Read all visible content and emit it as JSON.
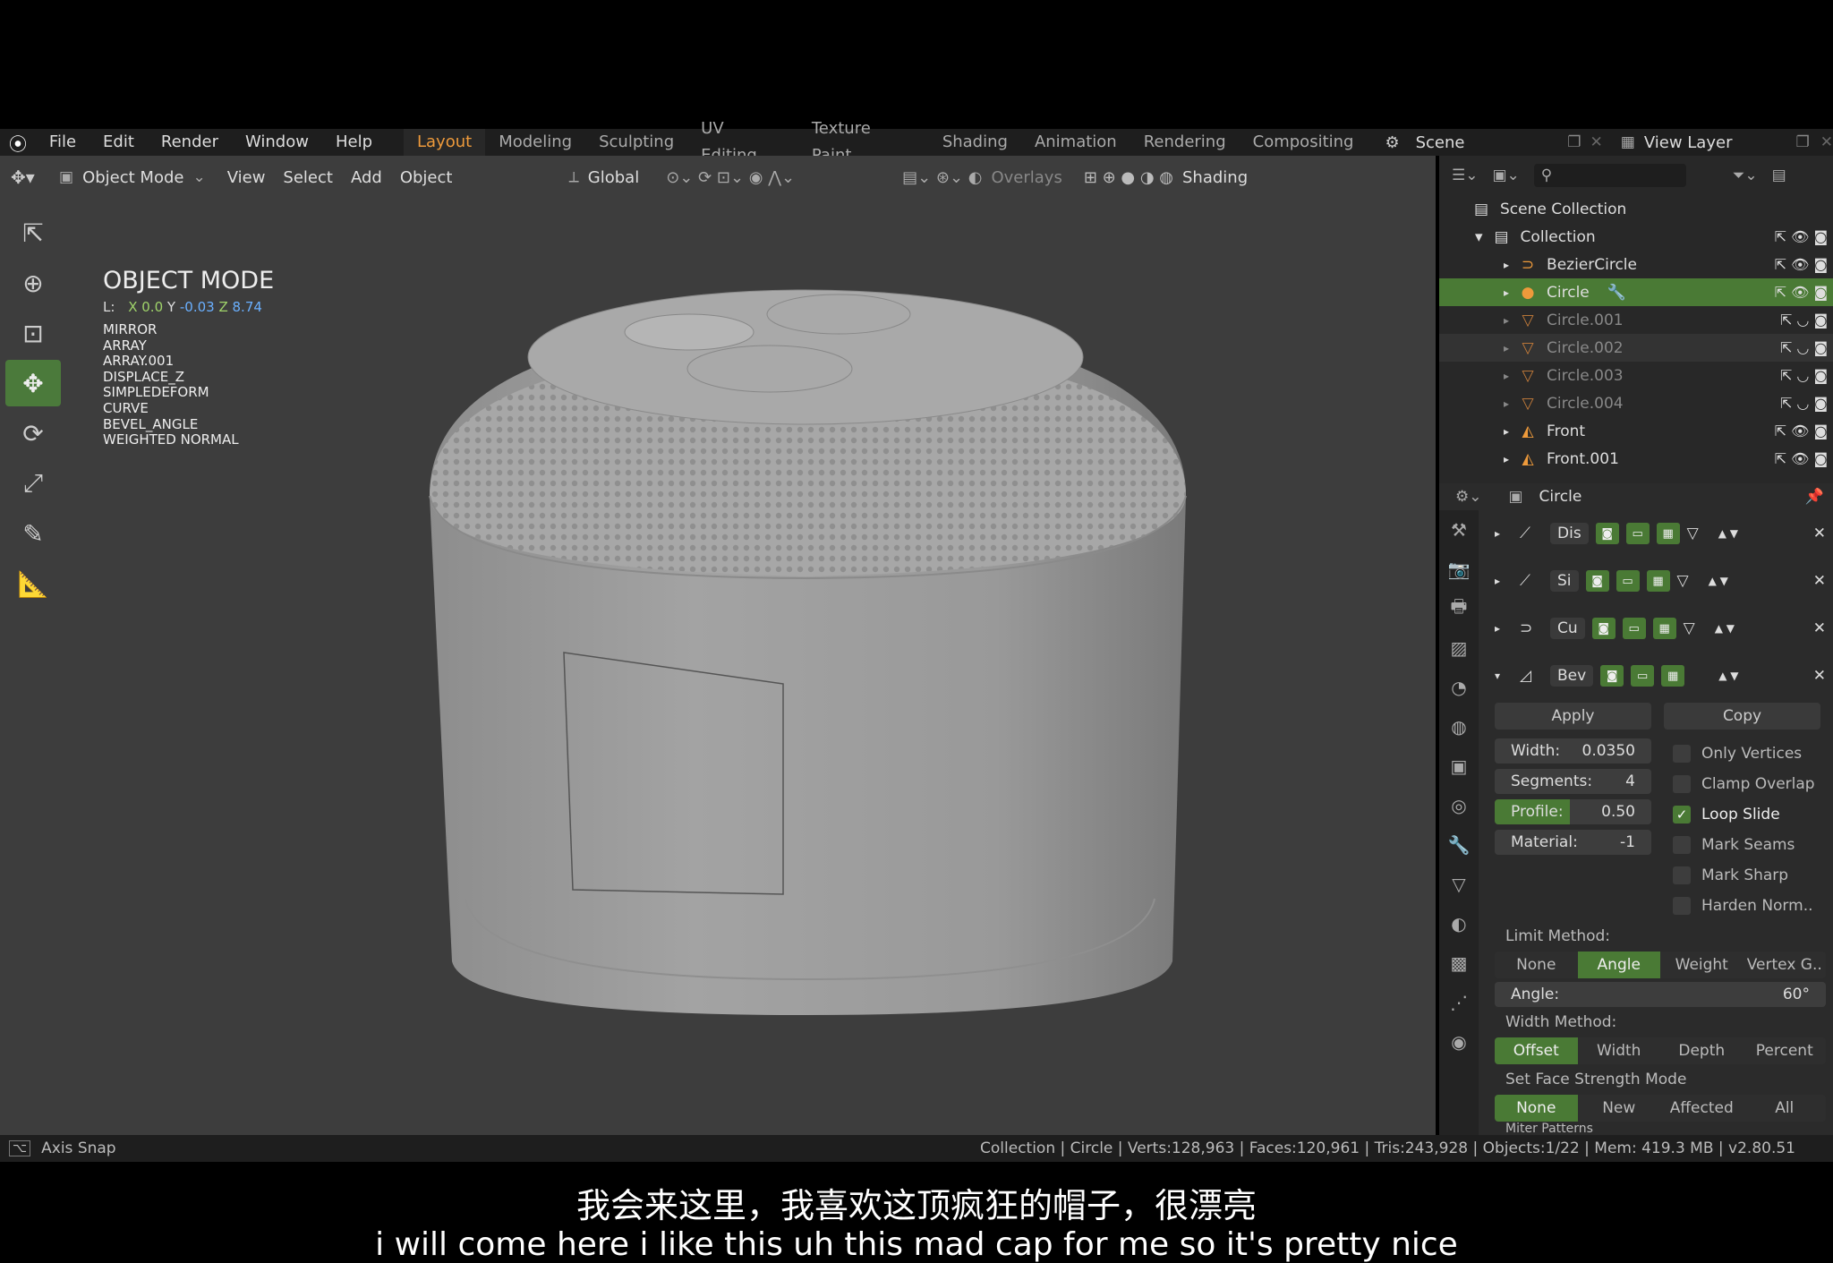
{
  "menu": [
    "File",
    "Edit",
    "Render",
    "Window",
    "Help"
  ],
  "workspaces": [
    "Layout",
    "Modeling",
    "Sculpting",
    "UV Editing",
    "Texture Paint",
    "Shading",
    "Animation",
    "Rendering",
    "Compositing"
  ],
  "scene_name": "Scene",
  "view_layer": "View Layer",
  "viewport_header": {
    "mode": "Object Mode",
    "menus": [
      "View",
      "Select",
      "Add",
      "Object"
    ],
    "orientation": "Global",
    "overlays": "Overlays",
    "shading": "Shading"
  },
  "overlay": {
    "mode_title": "OBJECT MODE",
    "loc_label": "L:",
    "x_label": "X",
    "x": "0.0",
    "y_label": "Y",
    "y": "-0.03",
    "z_label": "Z",
    "z": "8.74",
    "modifiers": [
      "MIRROR",
      "ARRAY",
      "ARRAY.001",
      "DISPLACE_Z",
      "SIMPLEDEFORM",
      "CURVE",
      "BEVEL_ANGLE",
      "WEIGHTED NORMAL"
    ]
  },
  "outliner": {
    "scene_collection": "Scene Collection",
    "collection": "Collection",
    "items": [
      {
        "name": "BezierCircle",
        "state": "normal"
      },
      {
        "name": "Circle",
        "state": "selected"
      },
      {
        "name": "Circle.001",
        "state": "dim"
      },
      {
        "name": "Circle.002",
        "state": "dim"
      },
      {
        "name": "Circle.003",
        "state": "dim"
      },
      {
        "name": "Circle.004",
        "state": "dim"
      },
      {
        "name": "Front",
        "state": "normal"
      },
      {
        "name": "Front.001",
        "state": "normal"
      }
    ]
  },
  "properties": {
    "object_name": "Circle",
    "modifiers": [
      {
        "short": "Dis"
      },
      {
        "short": "Si"
      },
      {
        "short": "Cu"
      },
      {
        "short": "Bev"
      }
    ],
    "apply": "Apply",
    "copy": "Copy",
    "width_label": "Width:",
    "width": "0.0350",
    "segments_label": "Segments:",
    "segments": "4",
    "profile_label": "Profile:",
    "profile": "0.50",
    "material_label": "Material:",
    "material": "-1",
    "checks": [
      {
        "label": "Only Vertices",
        "on": false
      },
      {
        "label": "Clamp Overlap",
        "on": false
      },
      {
        "label": "Loop Slide",
        "on": true
      },
      {
        "label": "Mark Seams",
        "on": false
      },
      {
        "label": "Mark Sharp",
        "on": false
      },
      {
        "label": "Harden Norm..",
        "on": false
      }
    ],
    "limit_method_label": "Limit Method:",
    "limit_methods": [
      "None",
      "Angle",
      "Weight",
      "Vertex G.."
    ],
    "angle_label": "Angle:",
    "angle": "60°",
    "width_method_label": "Width Method:",
    "width_methods": [
      "Offset",
      "Width",
      "Depth",
      "Percent"
    ],
    "face_strength_label": "Set Face Strength Mode",
    "face_strength": [
      "None",
      "New",
      "Affected",
      "All"
    ],
    "miter_label": "Miter Patterns"
  },
  "status": {
    "left": "Axis Snap",
    "right": "Collection | Circle | Verts:128,963 | Faces:120,961 | Tris:243,928 | Objects:1/22 | Mem: 419.3 MB | v2.80.51"
  },
  "subtitles": {
    "zh": "我会来这里，我喜欢这顶疯狂的帽子，很漂亮",
    "en": "i will come here i like this uh this mad cap for me so it's pretty nice"
  },
  "colors": {
    "accent": "#4a7a35",
    "active_workspace": "#ee9a3b",
    "axis_x": "#9fd36a",
    "axis_yz": "#6ab0ff"
  }
}
